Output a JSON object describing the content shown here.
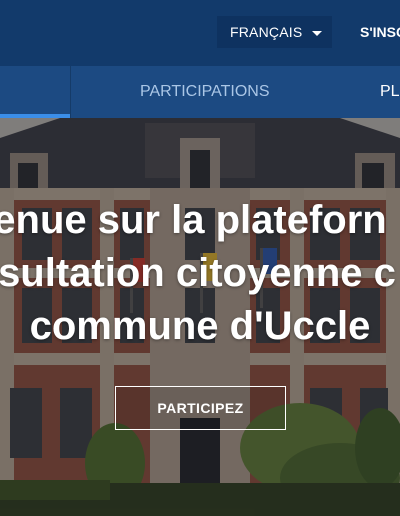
{
  "header": {
    "language": "FRANÇAIS",
    "signup_label": "S'INSC"
  },
  "nav": {
    "items": [
      {
        "label": "PARTICIPATIONS"
      },
      {
        "label": "PL"
      }
    ]
  },
  "hero": {
    "title_lines": [
      "enue sur la plateforn",
      "sultation citoyenne c",
      "commune d'Uccle"
    ],
    "cta_label": "PARTICIPEZ"
  },
  "colors": {
    "header_bg": "#123a6b",
    "nav_bg": "#1c4a82",
    "nav_active_underline": "#3b8ee8"
  }
}
